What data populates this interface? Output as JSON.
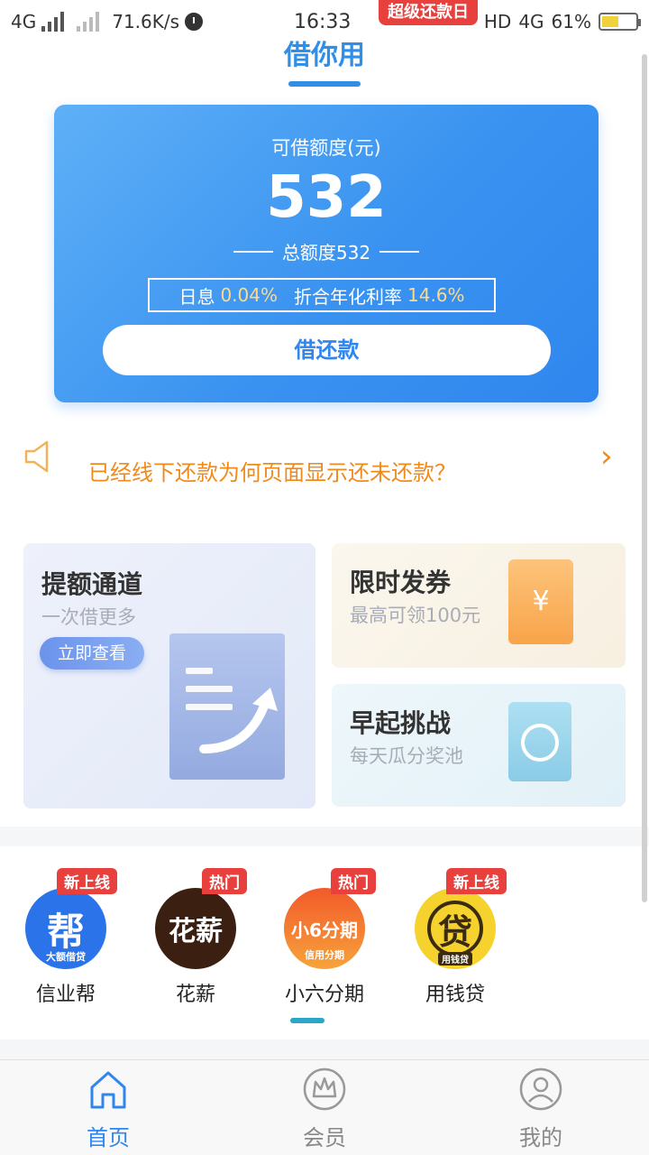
{
  "status_bar": {
    "network": "4G",
    "speed": "71.6K/s",
    "time": "16:33",
    "hd": "HD",
    "network2": "4G",
    "battery": "61%",
    "promo_tag": "超级还款日"
  },
  "header": {
    "title": "借你用"
  },
  "credit": {
    "label": "可借额度(元)",
    "amount": "532",
    "total": "总额度532",
    "daily_label": "日息",
    "daily_value": "0.04%",
    "annual_label": "折合年化利率",
    "annual_value": "14.6%",
    "button": "借还款"
  },
  "notice": {
    "text": "已经线下还款为何页面显示还未还款？"
  },
  "promos": {
    "quota": {
      "title": "提额通道",
      "subtitle": "一次借更多",
      "button": "立即查看"
    },
    "coupon": {
      "title": "限时发券",
      "subtitle": "最高可领100元",
      "symbol": "¥"
    },
    "early": {
      "title": "早起挑战",
      "subtitle": "每天瓜分奖池"
    }
  },
  "apps": [
    {
      "name": "信业帮",
      "badge": "新上线",
      "logo_text": "帮",
      "logo_sub": "大额借贷"
    },
    {
      "name": "花薪",
      "badge": "热门",
      "logo_text": "花薪"
    },
    {
      "name": "小六分期",
      "badge": "热门",
      "logo_text": "小6分期",
      "logo_sub": "信用分期"
    },
    {
      "name": "用钱贷",
      "badge": "新上线",
      "logo_text": "贷",
      "logo_sub": "用钱贷"
    }
  ],
  "tabs": [
    {
      "label": "首页",
      "icon": "home-icon",
      "active": true
    },
    {
      "label": "会员",
      "icon": "crown-icon",
      "active": false
    },
    {
      "label": "我的",
      "icon": "user-icon",
      "active": false
    }
  ],
  "colors": {
    "accent": "#2f86ee",
    "notice": "#f08a1b",
    "badge": "#e8413d"
  }
}
